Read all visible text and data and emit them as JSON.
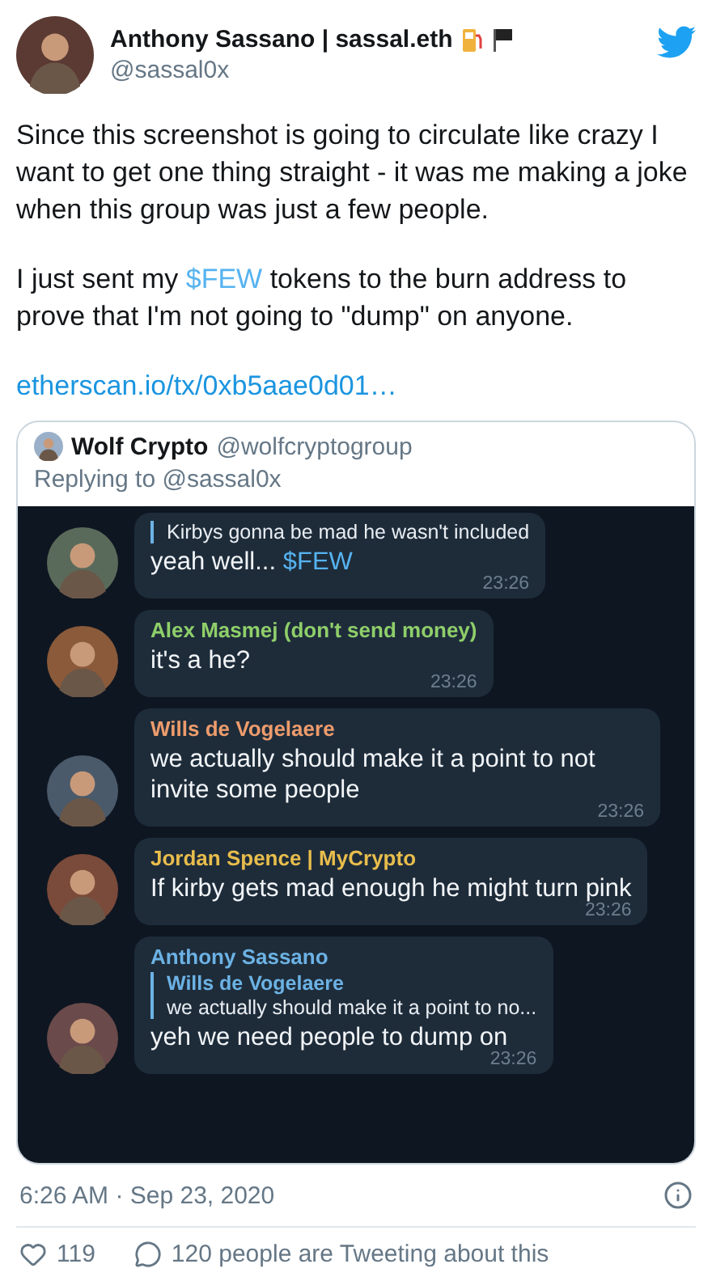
{
  "author": {
    "name": "Anthony Sassano | sassal.eth",
    "handle": "@sassal0x"
  },
  "paragraphs": [
    [
      {
        "kind": "text",
        "text": "Since this screenshot is going to circulate like crazy I want to get one thing straight - it was me making a joke when this group was just a few people."
      }
    ],
    [
      {
        "kind": "text",
        "text": "I just sent my "
      },
      {
        "kind": "cashtag",
        "text": "$FEW"
      },
      {
        "kind": "text",
        "text": " tokens to the burn address to prove that I'm not going to \"dump\" on anyone."
      }
    ],
    [
      {
        "kind": "link",
        "text": "etherscan.io/tx/0xb5aae0d01…"
      }
    ]
  ],
  "quoted": {
    "name": "Wolf Crypto",
    "handle": "@wolfcryptogroup",
    "replying": "Replying to @sassal0x",
    "messages": [
      {
        "quote_text": "Kirbys gonna be mad he wasn't included",
        "parts": [
          {
            "kind": "text",
            "text": "yeah well... "
          },
          {
            "kind": "cashtag",
            "text": "$FEW"
          }
        ],
        "time": "23:26"
      },
      {
        "sender": "Alex Masmej (don't send money)",
        "color": "#8fcf6a",
        "parts": [
          {
            "kind": "text",
            "text": "it's a he?"
          }
        ],
        "time": "23:26"
      },
      {
        "sender": "Wills de Vogelaere",
        "color": "#ee9c6c",
        "parts": [
          {
            "kind": "text",
            "text": "we actually should make it a point to not invite some people"
          }
        ],
        "time": "23:26"
      },
      {
        "sender": "Jordan Spence | MyCrypto",
        "color": "#e8bd4c",
        "parts": [
          {
            "kind": "text",
            "text": "If kirby gets mad enough he might turn pink"
          }
        ],
        "time": "23:26"
      },
      {
        "sender": "Anthony Sassano",
        "color": "#6cb2e4",
        "quote_sender": "Wills de Vogelaere",
        "quote_text": "we actually should make it a point to no...",
        "parts": [
          {
            "kind": "text",
            "text": "yeh we need people to dump on"
          }
        ],
        "time": "23:26"
      }
    ]
  },
  "timestamp": "6:26 AM · Sep 23, 2020",
  "likes": "119",
  "talking": "120 people are Tweeting about this"
}
